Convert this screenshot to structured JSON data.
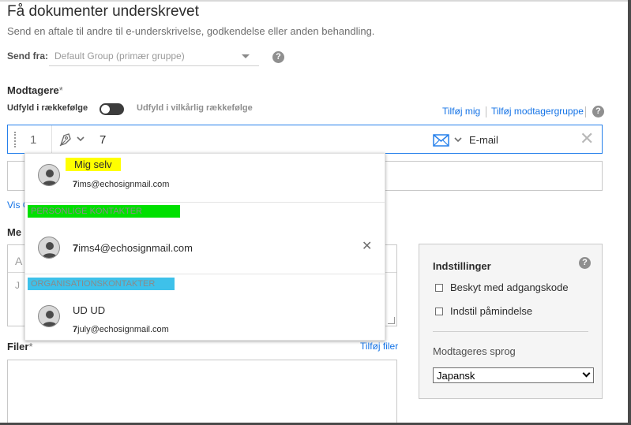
{
  "page": {
    "title": "Få dokumenter underskrevet",
    "subtitle": "Send en aftale til andre til e-underskrivelse, godkendelse eller anden behandling."
  },
  "send_from": {
    "label": "Send fra:",
    "value": "Default Group (primær gruppe)"
  },
  "recipients": {
    "label": "Modtagere",
    "required_mark": "*",
    "order_label": "Udfyld i rækkefølge",
    "any_order_label": "Udfyld i vilkårlig rækkefølge",
    "add_me": "Tilføj mig",
    "add_group": "Tilføj modtagergruppe",
    "row": {
      "number": "1",
      "typed_value": "7",
      "delivery": "E-mail"
    },
    "show_link": "Vis C"
  },
  "message": {
    "label": "Me",
    "name_placeholder": "A",
    "body_placeholder": "J"
  },
  "files": {
    "label": "Filer",
    "required_mark": "*",
    "add_files": "Tilføj filer"
  },
  "settings": {
    "title": "Indstillinger",
    "password_label": "Beskyt med adgangskode",
    "reminder_label": "Indstil påmindelse",
    "language_label": "Modtageres sprog",
    "language_value": "Japansk"
  },
  "dropdown": {
    "me": {
      "name": "Mig selv",
      "email_bold": "7",
      "email_rest": "ims@echosignmail.com"
    },
    "personal_header": "PERSONLIGE KONTAKTER",
    "personal": {
      "email_bold": "7",
      "email_rest": "ims4@echosignmail.com"
    },
    "org_header": "ORGANISATIONSKONTAKTER",
    "org": {
      "name": "UD UD",
      "email_bold": "7",
      "email_rest": "july@echosignmail.com"
    }
  },
  "colors": {
    "link": "#1473e6",
    "focus_border": "#2680eb",
    "highlight_yellow": "#ffff00",
    "highlight_green": "#00e000",
    "highlight_cyan": "#3ec1ea"
  },
  "icons": {
    "help": "question-circle-icon",
    "signer": "pen-nib-icon",
    "mail": "envelope-icon",
    "close": "close-icon",
    "avatar": "person-avatar-icon"
  }
}
